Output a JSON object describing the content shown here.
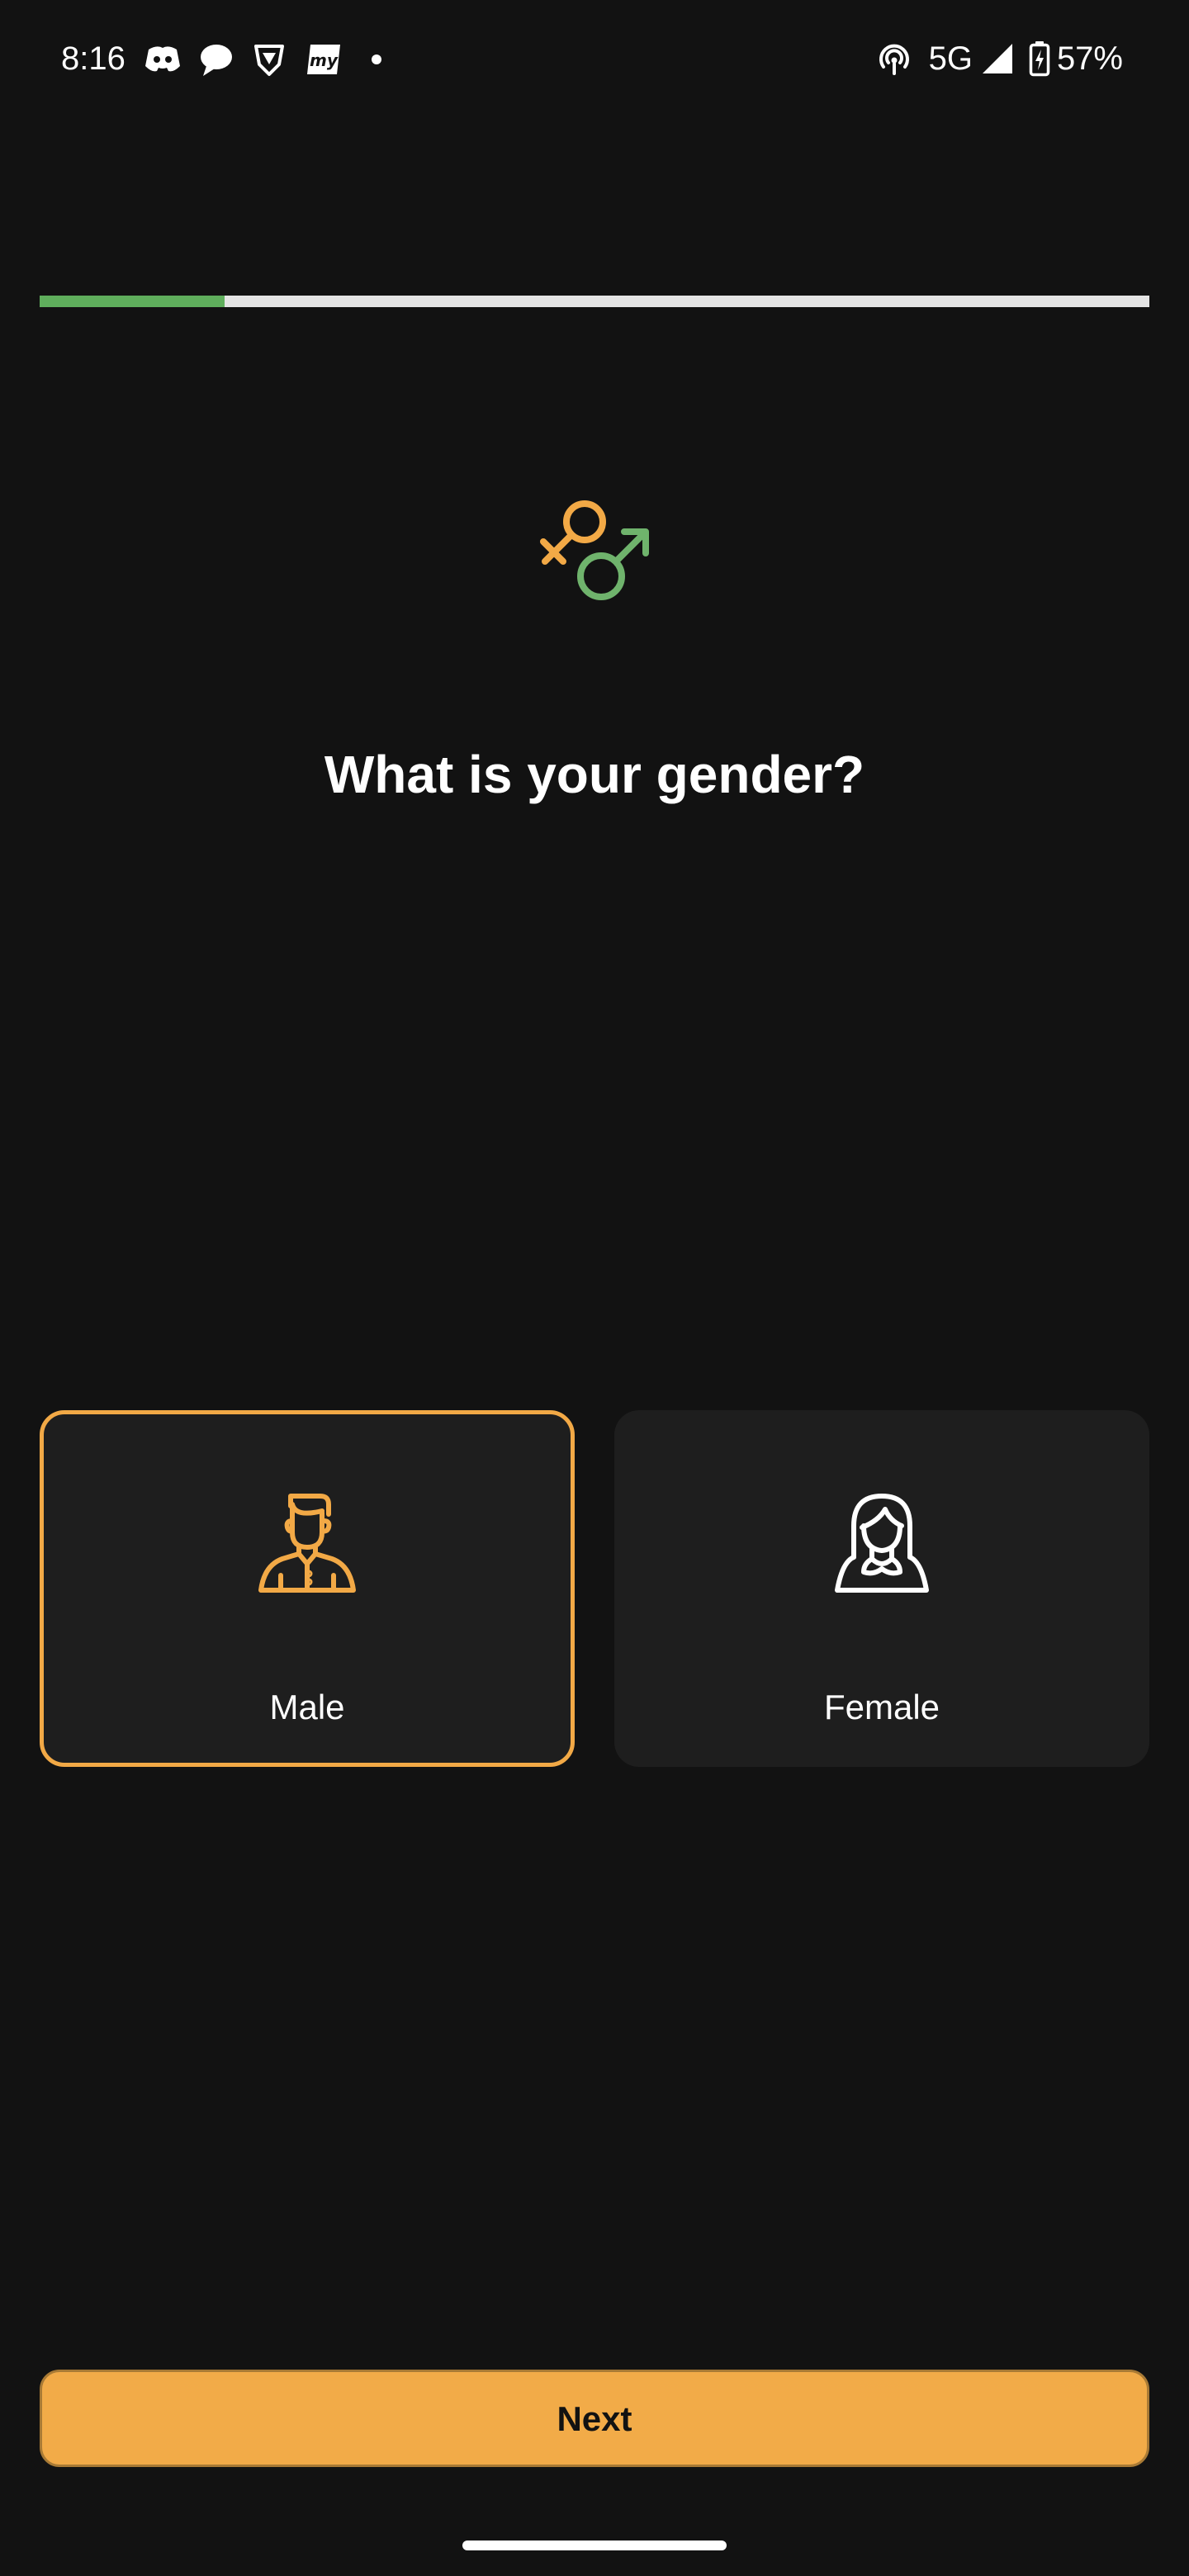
{
  "status_bar": {
    "time": "8:16",
    "network": "5G",
    "battery": "57%",
    "notification_icons": [
      "discord-icon",
      "chat-bubble-icon",
      "brave-icon",
      "myntra-icon",
      "dot-icon"
    ],
    "system_icons": [
      "hotspot-icon",
      "signal-icon",
      "battery-charging-icon"
    ]
  },
  "progress": {
    "value": 0.167,
    "fill_color": "#5fae5c",
    "track_color": "#e4e4e4"
  },
  "header": {
    "icon": "gender-symbol-icon",
    "title": "What is your gender?"
  },
  "options": [
    {
      "id": "male",
      "label": "Male",
      "icon": "male-person-icon",
      "selected": true
    },
    {
      "id": "female",
      "label": "Female",
      "icon": "female-person-icon",
      "selected": false
    }
  ],
  "next_button": {
    "label": "Next"
  },
  "colors": {
    "background": "#121212",
    "card": "#1e1e1e",
    "accent": "#f2a946",
    "green": "#6fb36c",
    "text": "#ffffff",
    "button_text": "#121212"
  }
}
